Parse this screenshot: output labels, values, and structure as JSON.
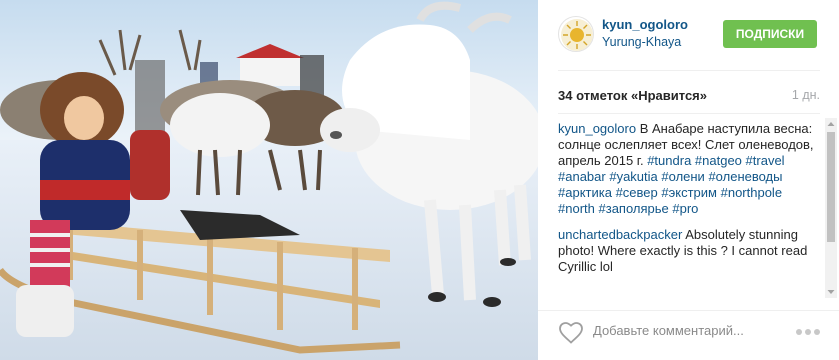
{
  "post": {
    "username": "kyun_ogoloro",
    "location": "Yurung-Khaya",
    "follow_label": "ПОДПИСКИ",
    "likes": "34 отметок «Нравится»",
    "timestamp": "1 дн.",
    "avatar_icon": "sun-logo-icon"
  },
  "caption": {
    "user": "kyun_ogoloro",
    "text": "В Анабаре наступила весна: солнце ослепляет всех! Слет оленеводов, апрель 2015 г.",
    "tags": [
      "#tundra",
      "#natgeo",
      "#travel",
      "#anabar",
      "#yakutia",
      "#олени",
      "#оленеводы",
      "#арктика",
      "#север",
      "#экстрим",
      "#northpole",
      "#north",
      "#заполярье",
      "#pro"
    ]
  },
  "comments": [
    {
      "user": "unchartedbackpacker",
      "text": "Absolutely stunning photo! Where exactly is this ? I cannot read Cyrillic lol"
    }
  ],
  "footer": {
    "add_comment_placeholder": "Добавьте комментарий...",
    "heart_icon": "heart-icon",
    "more_icon": "more-options-icon"
  },
  "colors": {
    "link_blue": "#125688",
    "follow_green": "#70c050",
    "muted_gray": "#a5a7aa"
  }
}
